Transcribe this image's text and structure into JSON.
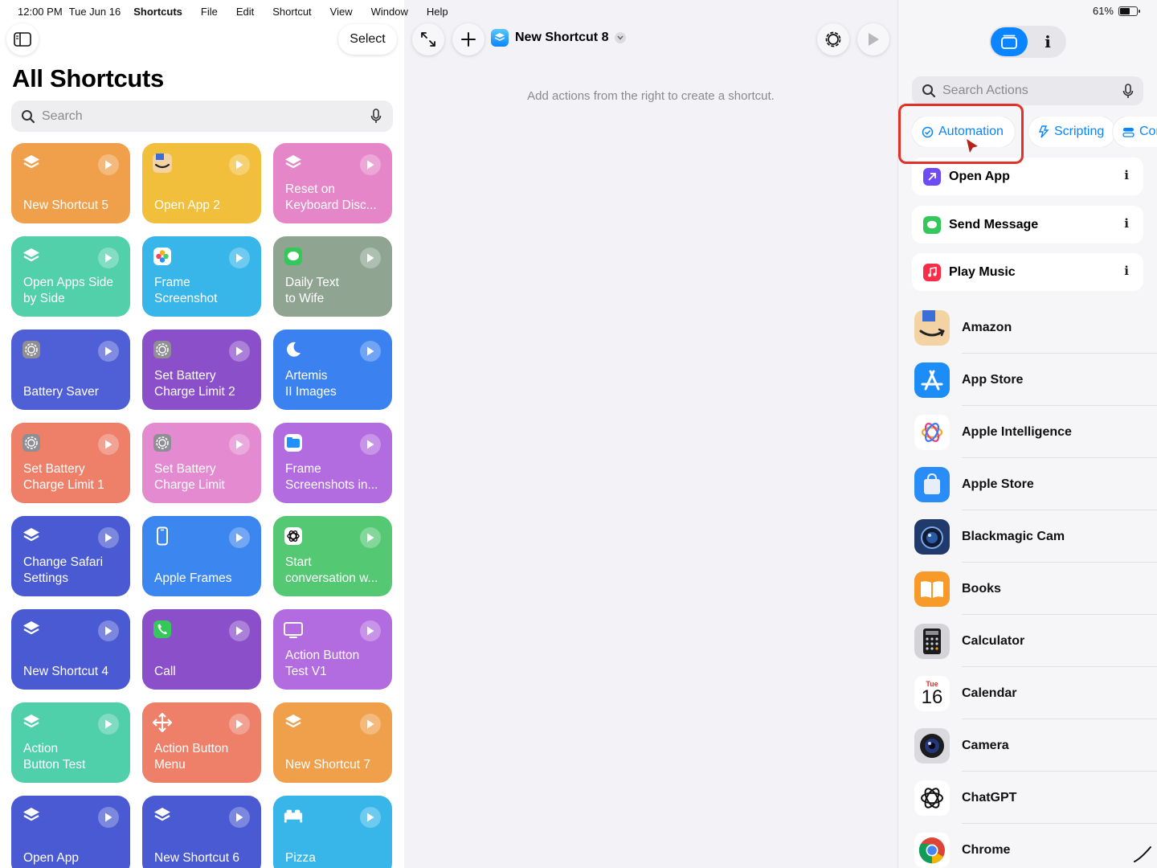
{
  "status_bar": {
    "time": "12:00 PM",
    "date": "Tue Jun 16",
    "battery": "61%",
    "battery_level": 0.61
  },
  "menu": {
    "app_name": "Shortcuts",
    "items": [
      "File",
      "Edit",
      "Shortcut",
      "View",
      "Window",
      "Help"
    ]
  },
  "left": {
    "select_label": "Select",
    "title": "All Shortcuts",
    "search_placeholder": "Search",
    "tiles": [
      {
        "name": "New Shortcut 5",
        "icon": "layers-icon",
        "color": "#f0a04b"
      },
      {
        "name": "Open App 2",
        "icon": "amazon-icon",
        "color": "#f2bf3c"
      },
      {
        "name": "Reset on\nKeyboard Disc...",
        "icon": "layers-icon",
        "color": "#e586c8"
      },
      {
        "name": "Open Apps Side\nby Side",
        "icon": "layers-icon",
        "color": "#52d0a9"
      },
      {
        "name": "Frame\nScreenshot",
        "icon": "photos-icon",
        "color": "#38b6ea"
      },
      {
        "name": "Daily Text\nto Wife",
        "icon": "messages-icon",
        "color": "#8fa592"
      },
      {
        "name": "Battery Saver",
        "icon": "settings-icon",
        "color": "#4f5fd6"
      },
      {
        "name": "Set Battery\nCharge Limit 2",
        "icon": "settings-icon",
        "color": "#8a4fc9"
      },
      {
        "name": "Artemis\nII Images",
        "icon": "moon-icon",
        "color": "#3b82f0"
      },
      {
        "name": "Set Battery\nCharge Limit 1",
        "icon": "settings-icon",
        "color": "#ee7f68"
      },
      {
        "name": "Set Battery\nCharge Limit",
        "icon": "settings-icon",
        "color": "#e38ad0"
      },
      {
        "name": "Frame\nScreenshots in...",
        "icon": "files-icon",
        "color": "#b36be0"
      },
      {
        "name": "Change Safari\nSettings",
        "icon": "layers-icon",
        "color": "#4a5ad2"
      },
      {
        "name": "Apple Frames",
        "icon": "phone-outline-icon",
        "color": "#3c86f0"
      },
      {
        "name": "Start\nconversation w...",
        "icon": "chatgpt-icon",
        "color": "#54c873"
      },
      {
        "name": "New Shortcut 4",
        "icon": "layers-icon",
        "color": "#4a5ad2"
      },
      {
        "name": "Call",
        "icon": "phone-icon",
        "color": "#8a4fc9"
      },
      {
        "name": "Action Button\nTest V1",
        "icon": "laptop-icon",
        "color": "#b36be0"
      },
      {
        "name": "Action\nButton Test",
        "icon": "layers-icon",
        "color": "#4fcfaa"
      },
      {
        "name": "Action Button\nMenu",
        "icon": "move-icon",
        "color": "#ee7f68"
      },
      {
        "name": "New Shortcut 7",
        "icon": "layers-icon",
        "color": "#f0a04b"
      },
      {
        "name": "Open App",
        "icon": "layers-icon",
        "color": "#4a5ad2"
      },
      {
        "name": "New Shortcut 6",
        "icon": "layers-icon",
        "color": "#4a5ad2"
      },
      {
        "name": "Pizza",
        "icon": "bed-icon",
        "color": "#38b6ea"
      }
    ]
  },
  "editor": {
    "shortcut_name": "New Shortcut 8",
    "empty_hint": "Add actions from the right to create a shortcut."
  },
  "actions_panel": {
    "search_placeholder": "Search Actions",
    "categories": [
      {
        "label": "Automation",
        "icon": "automation-icon"
      },
      {
        "label": "Scripting",
        "icon": "scripting-icon"
      },
      {
        "label": "Controls",
        "icon": "controls-icon"
      }
    ],
    "suggestions": [
      {
        "label": "Open App",
        "icon": "open-app-icon",
        "color": "#6e4cf5"
      },
      {
        "label": "Send Message",
        "icon": "messages-icon",
        "color": "#34c759"
      },
      {
        "label": "Play Music",
        "icon": "music-icon",
        "color": "#fa2d48"
      }
    ],
    "apps": [
      {
        "label": "Amazon",
        "icon": "amazon-icon"
      },
      {
        "label": "App Store",
        "icon": "app-store-icon"
      },
      {
        "label": "Apple Intelligence",
        "icon": "apple-intelligence-icon"
      },
      {
        "label": "Apple Store",
        "icon": "apple-store-icon"
      },
      {
        "label": "Blackmagic Cam",
        "icon": "blackmagic-cam-icon"
      },
      {
        "label": "Books",
        "icon": "books-icon"
      },
      {
        "label": "Calculator",
        "icon": "calculator-icon"
      },
      {
        "label": "Calendar",
        "icon": "calendar-icon",
        "cal_day": "Tue",
        "cal_date": "16"
      },
      {
        "label": "Camera",
        "icon": "camera-icon"
      },
      {
        "label": "ChatGPT",
        "icon": "chatgpt-icon"
      },
      {
        "label": "Chrome",
        "icon": "chrome-icon"
      }
    ]
  }
}
